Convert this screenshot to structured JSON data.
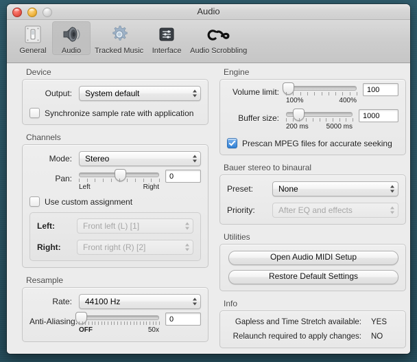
{
  "window": {
    "title": "Audio",
    "traffic_lights": [
      "close",
      "minimize",
      "zoom"
    ]
  },
  "toolbar": {
    "items": [
      {
        "label": "General",
        "icon": "switch-plate-icon",
        "selected": false
      },
      {
        "label": "Audio",
        "icon": "speaker-icon",
        "selected": true
      },
      {
        "label": "Tracked Music",
        "icon": "gear-icon",
        "selected": false
      },
      {
        "label": "Interface",
        "icon": "sliders-panel-icon",
        "selected": false
      },
      {
        "label": "Audio Scrobbling",
        "icon": "lastfm-logo-icon",
        "selected": false
      }
    ]
  },
  "device": {
    "title": "Device",
    "output_label": "Output:",
    "output_value": "System default",
    "sync_checkbox_label": "Synchronize sample rate with application",
    "sync_checked": false
  },
  "channels": {
    "title": "Channels",
    "mode_label": "Mode:",
    "mode_value": "Stereo",
    "pan_label": "Pan:",
    "pan_value": "0",
    "pan_scale_low": "Left",
    "pan_scale_high": "Right",
    "custom_checkbox_label": "Use custom assignment",
    "custom_checked": false,
    "left_label": "Left:",
    "left_value": "Front left (L) [1]",
    "right_label": "Right:",
    "right_value": "Front right (R) [2]"
  },
  "resample": {
    "title": "Resample",
    "rate_label": "Rate:",
    "rate_value": "44100 Hz",
    "aa_label": "Anti-Aliasing:",
    "aa_value": "0",
    "aa_scale_low": "OFF",
    "aa_scale_high": "50x"
  },
  "engine": {
    "title": "Engine",
    "volume_label": "Volume limit:",
    "volume_value": "100",
    "volume_scale_low": "100%",
    "volume_scale_high": "400%",
    "buffer_label": "Buffer size:",
    "buffer_value": "1000",
    "buffer_scale_low": "200 ms",
    "buffer_scale_high": "5000 ms",
    "prescan_label": "Prescan MPEG files for accurate seeking",
    "prescan_checked": true
  },
  "bauer": {
    "title": "Bauer stereo to binaural",
    "preset_label": "Preset:",
    "preset_value": "None",
    "priority_label": "Priority:",
    "priority_value": "After EQ and effects"
  },
  "utilities": {
    "title": "Utilities",
    "midi_button": "Open Audio MIDI Setup",
    "restore_button": "Restore Default Settings"
  },
  "info": {
    "title": "Info",
    "rows": [
      {
        "label": "Gapless and Time Stretch available:",
        "value": "YES"
      },
      {
        "label": "Relaunch required to apply changes:",
        "value": "NO"
      }
    ]
  },
  "colors": {
    "accent_checkbox": "#2f7fd4",
    "window_bg": "#ececec",
    "desktop": "#2b5463"
  }
}
